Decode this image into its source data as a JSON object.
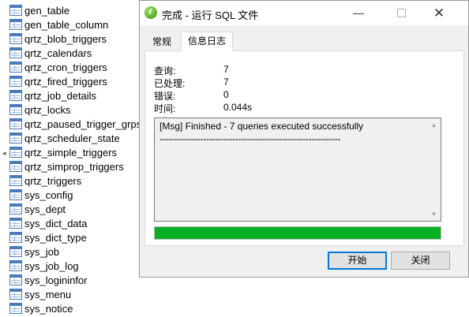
{
  "tree": {
    "tables": [
      "gen_table",
      "gen_table_column",
      "qrtz_blob_triggers",
      "qrtz_calendars",
      "qrtz_cron_triggers",
      "qrtz_fired_triggers",
      "qrtz_job_details",
      "qrtz_locks",
      "qrtz_paused_trigger_grps",
      "qrtz_scheduler_state",
      "qrtz_simple_triggers",
      "qrtz_simprop_triggers",
      "qrtz_triggers",
      "sys_config",
      "sys_dept",
      "sys_dict_data",
      "sys_dict_type",
      "sys_job",
      "sys_job_log",
      "sys_logininfor",
      "sys_menu",
      "sys_notice"
    ]
  },
  "dialog": {
    "title": "完成 - 运行 SQL 文件",
    "window_buttons": {
      "minimize": "—",
      "close": "✕"
    },
    "tabs": [
      {
        "label": "常规"
      },
      {
        "label": "信息日志"
      }
    ],
    "active_tab": "信息日志",
    "stats": [
      {
        "label": "查询:",
        "value": "7"
      },
      {
        "label": "已处理:",
        "value": "7"
      },
      {
        "label": "错误:",
        "value": "0"
      },
      {
        "label": "时间:",
        "value": "0.044s"
      }
    ],
    "log": {
      "line1": "[Msg] Finished - 7 queries executed successfully",
      "line2": "--------------------------------------------------------------",
      "scroll_up": "▲",
      "scroll_down": "▼"
    },
    "progress_fraction": 1.0,
    "progress_color": "#06b025",
    "buttons": {
      "start": "开始",
      "close": "关闭"
    }
  },
  "icons": {
    "table_icon": "table-icon",
    "app_icon": "navicat-icon"
  }
}
